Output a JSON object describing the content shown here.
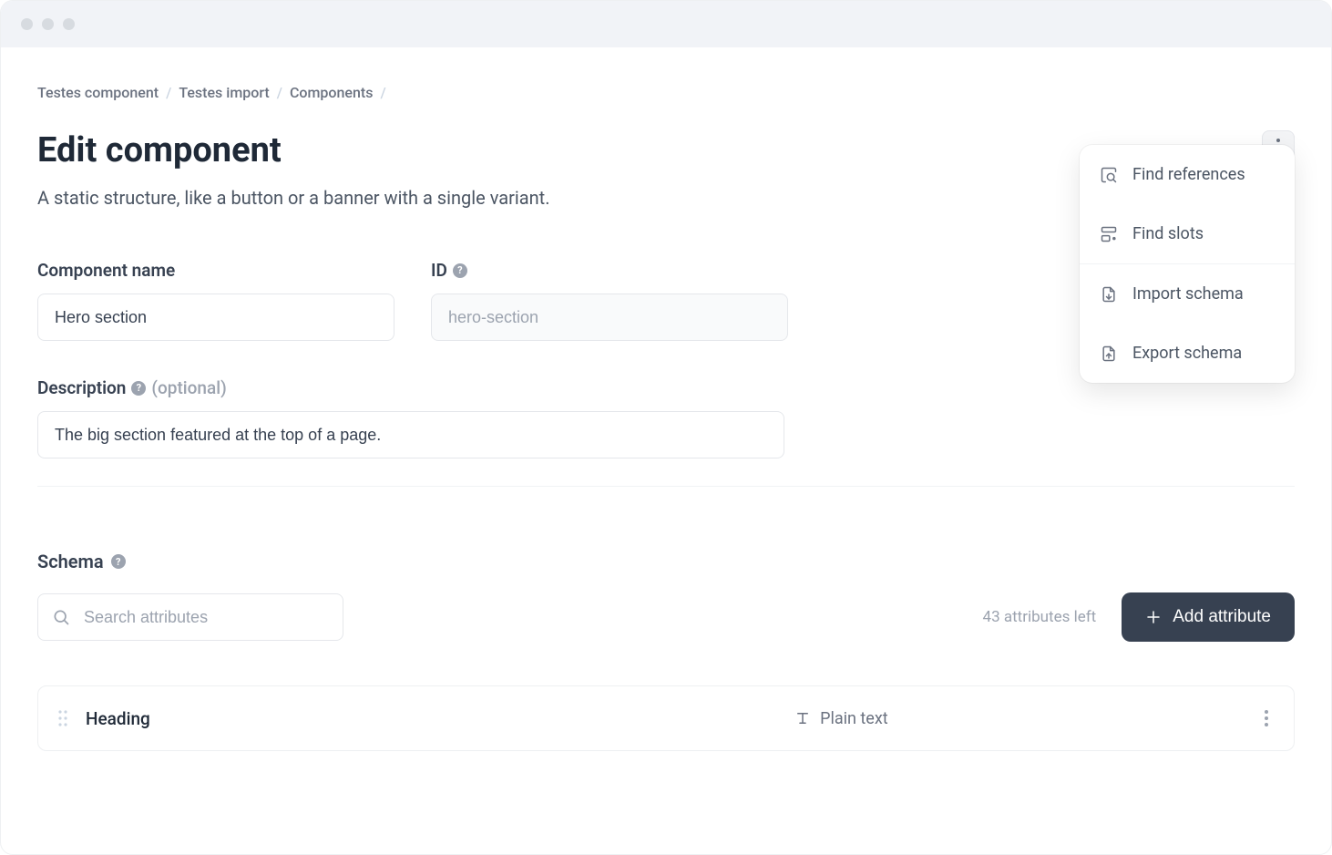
{
  "breadcrumb": {
    "items": [
      "Testes component",
      "Testes import",
      "Components"
    ]
  },
  "header": {
    "title": "Edit component",
    "subtitle": "A static structure, like a button or a banner with a single variant."
  },
  "menu": {
    "find_references": "Find references",
    "find_slots": "Find slots",
    "import_schema": "Import schema",
    "export_schema": "Export schema"
  },
  "form": {
    "name_label": "Component name",
    "name_value": "Hero section",
    "id_label": "ID",
    "id_value": "hero-section",
    "desc_label": "Description",
    "desc_optional": "(optional)",
    "desc_value": "The big section featured at the top of a page."
  },
  "schema": {
    "label": "Schema",
    "search_placeholder": "Search attributes",
    "attrs_left": "43 attributes left",
    "add_button": "Add attribute",
    "rows": [
      {
        "name": "Heading",
        "type": "Plain text"
      }
    ]
  }
}
